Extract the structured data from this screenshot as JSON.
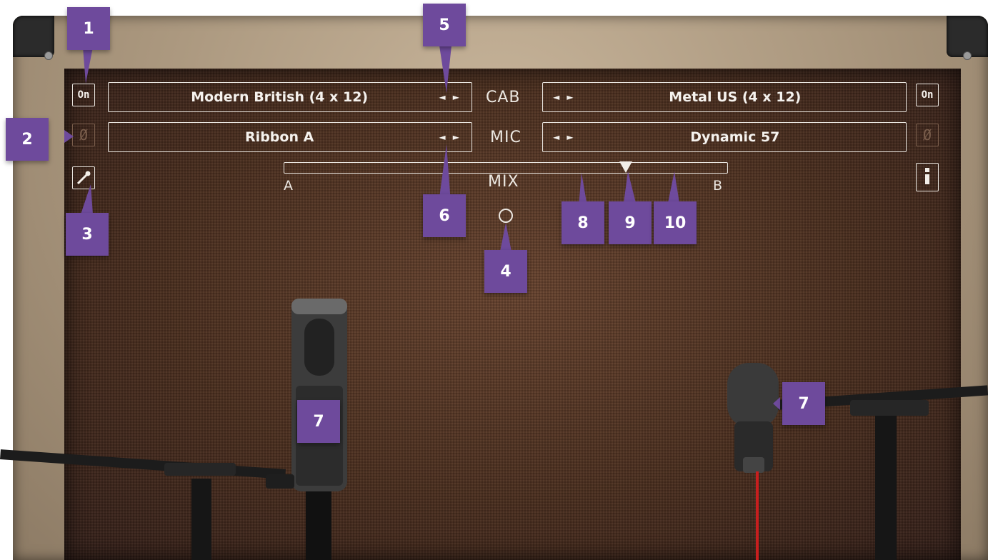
{
  "cab_a": {
    "on_label": "On",
    "cabinet_name": "Modern British (4 x 12)",
    "mic_name": "Ribbon A",
    "phase_symbol": "Ø",
    "arrows": "◄ ►"
  },
  "cab_b": {
    "on_label": "On",
    "cabinet_name": "Metal US (4 x 12)",
    "mic_name": "Dynamic 57",
    "phase_symbol": "Ø",
    "arrows": "◄ ►"
  },
  "labels": {
    "cab": "CAB",
    "mic": "MIC",
    "mix": "MIX",
    "a": "A",
    "b": "B"
  },
  "mix_position": 0.77,
  "icons": {
    "mic_edit": "mic-pen-icon",
    "info": "info-icon",
    "reset": "circle-reset-icon"
  },
  "colors": {
    "callout": "#6e4a9c",
    "grille": "#4d3020",
    "tolex": "#a8957c",
    "cable": "#c81e1e"
  },
  "callouts": {
    "c1": "1",
    "c2": "2",
    "c3": "3",
    "c4": "4",
    "c5": "5",
    "c6": "6",
    "c7a": "7",
    "c7b": "7",
    "c8": "8",
    "c9": "9",
    "c10": "10"
  }
}
